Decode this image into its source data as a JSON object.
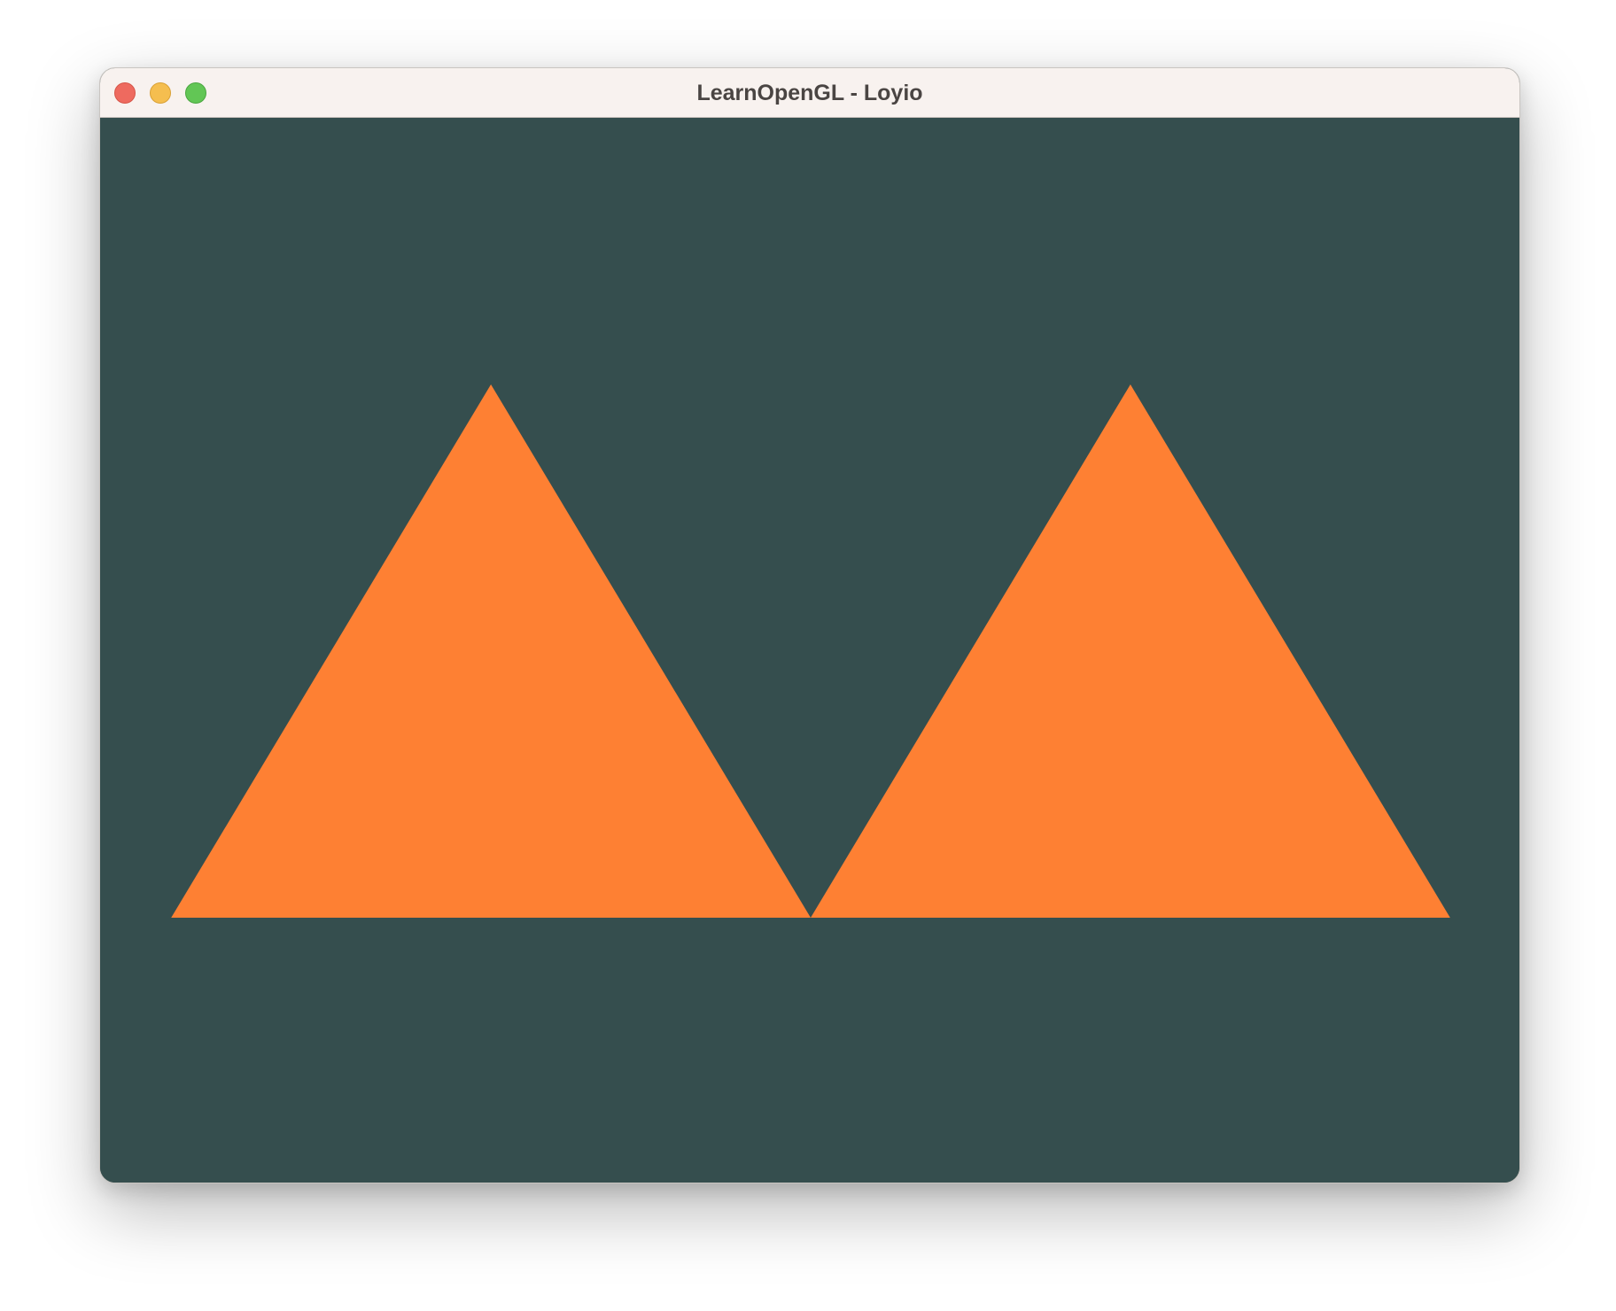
{
  "window": {
    "title": "LearnOpenGL - Loyio"
  },
  "colors": {
    "clear_color": "#354e4e",
    "triangle_fill": "#fe8033",
    "titlebar_bg": "#f8f2ef",
    "close": "#ee6a5f",
    "minimize": "#f5be4f",
    "maximize": "#62c655"
  },
  "scene": {
    "triangles": [
      {
        "name": "left-triangle",
        "vertices": [
          [
            -0.9,
            -0.5
          ],
          [
            0.0,
            -0.5
          ],
          [
            -0.45,
            0.5
          ]
        ]
      },
      {
        "name": "right-triangle",
        "vertices": [
          [
            0.0,
            -0.5
          ],
          [
            0.9,
            -0.5
          ],
          [
            0.45,
            0.5
          ]
        ]
      }
    ]
  }
}
